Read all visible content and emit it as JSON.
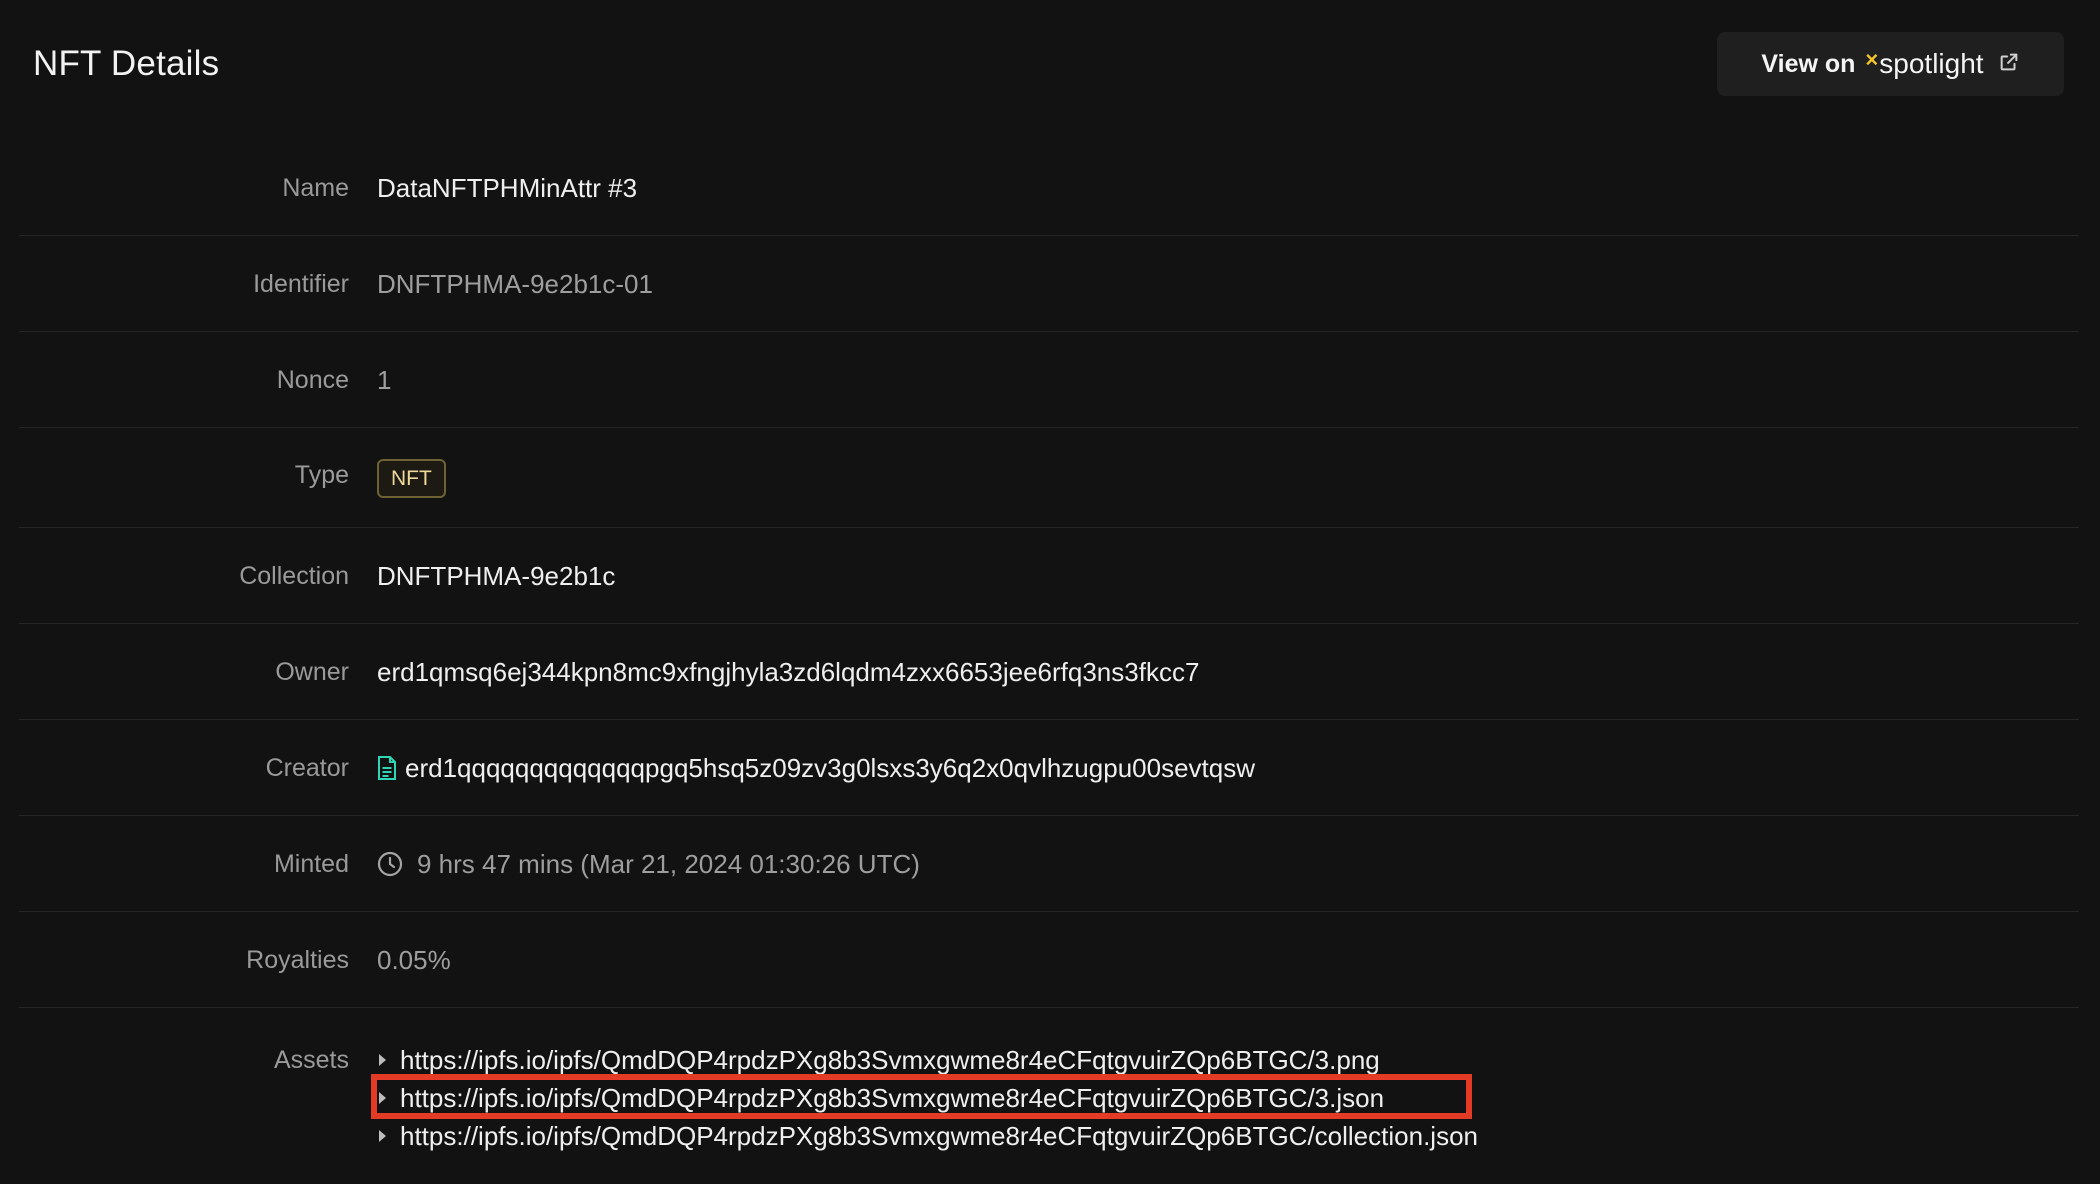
{
  "header": {
    "title": "NFT Details",
    "view_on_label": "View on",
    "view_on_brand": "spotlight",
    "view_on_brand_mark": "×",
    "external_icon": "external-link-icon"
  },
  "details": {
    "name": {
      "label": "Name",
      "value": "DataNFTPHMinAttr #3"
    },
    "identifier": {
      "label": "Identifier",
      "value": "DNFTPHMA-9e2b1c-01"
    },
    "nonce": {
      "label": "Nonce",
      "value": "1"
    },
    "type": {
      "label": "Type",
      "value": "NFT"
    },
    "collection": {
      "label": "Collection",
      "value": "DNFTPHMA-9e2b1c"
    },
    "owner": {
      "label": "Owner",
      "value": "erd1qmsq6ej344kpn8mc9xfngjhyla3zd6lqdm4zxx6653jee6rfq3ns3fkcc7"
    },
    "creator": {
      "label": "Creator",
      "value": "erd1qqqqqqqqqqqqqpgq5hsq5z09zv3g0lsxs3y6q2x0qvlhzugpu00sevtqsw",
      "icon": "contract-file-icon"
    },
    "minted": {
      "label": "Minted",
      "value": "9 hrs 47 mins (Mar 21, 2024 01:30:26 UTC)",
      "icon": "clock-icon"
    },
    "royalties": {
      "label": "Royalties",
      "value": "0.05%"
    }
  },
  "assets": {
    "label": "Assets",
    "items": [
      "https://ipfs.io/ipfs/QmdDQP4rpdzPXg8b3Svmxgwme8r4eCFqtgvuirZQp6BTGC/3.png",
      "https://ipfs.io/ipfs/QmdDQP4rpdzPXg8b3Svmxgwme8r4eCFqtgvuirZQp6BTGC/3.json",
      "https://ipfs.io/ipfs/QmdDQP4rpdzPXg8b3Svmxgwme8r4eCFqtgvuirZQp6BTGC/collection.json"
    ]
  },
  "colors": {
    "background": "#121212",
    "highlight": "#e33b26",
    "badge_text": "#f0d89a",
    "brand_accent": "#f5c52c",
    "creator_icon": "#2fd6b5"
  }
}
